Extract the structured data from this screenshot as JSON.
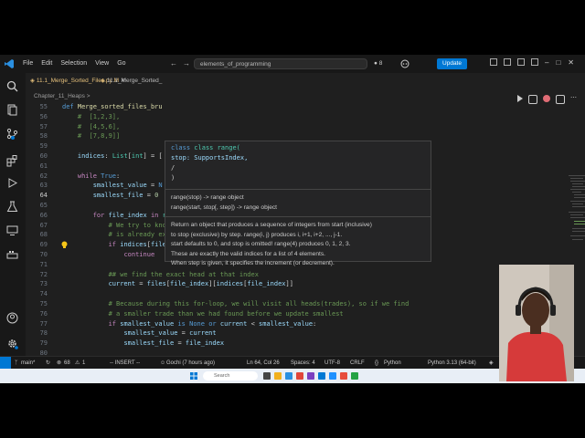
{
  "window": {
    "menu": [
      "File",
      "Edit",
      "Selection",
      "View",
      "Go"
    ],
    "command_center": "elements_of_programming",
    "notification_count": "8",
    "update_button": "Update"
  },
  "tabs": {
    "active": "11.1_Merge_Sorted_Files.py  M",
    "second": "11.1_Merge_Sorted_"
  },
  "breadcrumb": "Chapter_11_Heaps  >",
  "code": {
    "lines": [
      {
        "n": "55",
        "text": "def Merge_sorted_files_bru"
      },
      {
        "n": "56",
        "text": "    #  [1,2,3],"
      },
      {
        "n": "57",
        "text": "    #  [4,5,6],"
      },
      {
        "n": "58",
        "text": "    #  [7,8,9]]"
      },
      {
        "n": "59",
        "text": ""
      },
      {
        "n": "60",
        "text": "    indices: List[int] = ["
      },
      {
        "n": "61",
        "text": ""
      },
      {
        "n": "62",
        "text": "    while True:"
      },
      {
        "n": "63",
        "text": "        smallest_value = N"
      },
      {
        "n": "64",
        "text": "        smallest_file = 0"
      },
      {
        "n": "65",
        "text": ""
      },
      {
        "n": "66",
        "text": "        for file_index in range(len(files)):"
      },
      {
        "n": "67",
        "text": "            # We try to know if the list at the index in focus(file_index)"
      },
      {
        "n": "68",
        "text": "            # is already exhausted."
      },
      {
        "n": "69",
        "text": "            if indices[file_index] >= len(files[file_index]):"
      },
      {
        "n": "70",
        "text": "                continue"
      },
      {
        "n": "71",
        "text": ""
      },
      {
        "n": "72",
        "text": "            ## we find the exact head at that index"
      },
      {
        "n": "73",
        "text": "            current = files[file_index][indices[file_index]]"
      },
      {
        "n": "74",
        "text": ""
      },
      {
        "n": "75",
        "text": "            # Because during this for-loop, we will visit all heads(trades), so if we find"
      },
      {
        "n": "76",
        "text": "            # a smaller trade than we had found before we update smallest"
      },
      {
        "n": "77",
        "text": "            if smallest_value is None or current < smallest_value:"
      },
      {
        "n": "78",
        "text": "                smallest_value = current"
      },
      {
        "n": "79",
        "text": "                smallest_file = file_index"
      },
      {
        "n": "80",
        "text": ""
      }
    ]
  },
  "hover": {
    "sig_line1": "class range(",
    "sig_line2": "    stop: SupportsIndex,",
    "sig_line3": "    /",
    "sig_line4": ")",
    "usage1": "range(stop) -> range object",
    "usage2": "range(start, stop[, step]) -> range object",
    "doc1": "Return an object that produces a sequence of integers from start (inclusive)",
    "doc2": "to stop (exclusive) by step. range(i, j) produces i, i+1, i+2, ..., j-1.",
    "doc3": "start defaults to 0, and stop is omitted! range(4) produces 0, 1, 2, 3.",
    "doc4": "These are exactly the valid indices for a list of 4 elements.",
    "doc5": "When step is given, it specifies the increment (or decrement)."
  },
  "status": {
    "branch": "main*",
    "sync": "",
    "problems": "68",
    "warnings": "1",
    "mode": "-- INSERT --",
    "blame": "Gochi (7 hours ago)",
    "position": "Ln 64, Col 26",
    "spaces": "Spaces: 4",
    "encoding": "UTF-8",
    "eol": "CRLF",
    "language": "Python",
    "interpreter": "Python 3.13 (64-bit)"
  },
  "taskbar": {
    "search_placeholder": "Search"
  },
  "colors": {
    "accent": "#0078d4",
    "editor_bg": "#1f1f1f",
    "keyword": "#c586c0",
    "builtin": "#dcdcaa",
    "comment": "#6a9955"
  }
}
